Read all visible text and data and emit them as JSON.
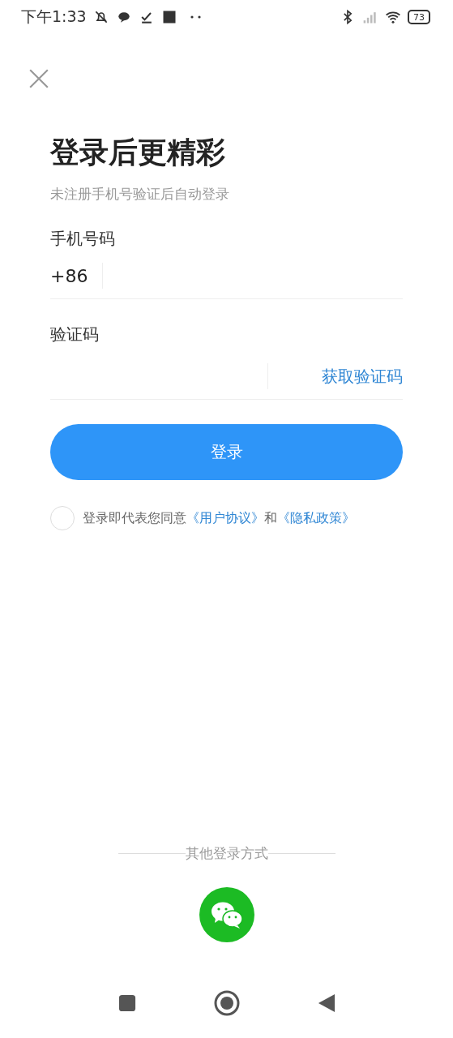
{
  "status_bar": {
    "time": "下午1:33",
    "battery": "73"
  },
  "title": "登录后更精彩",
  "subtitle": "未注册手机号验证后自动登录",
  "phone": {
    "label": "手机号码",
    "prefix": "+86"
  },
  "code": {
    "label": "验证码",
    "action": "获取验证码"
  },
  "login_button": "登录",
  "agreement": {
    "checked": false,
    "parts": [
      {
        "kind": "text",
        "text": "登录即代表您同意"
      },
      {
        "kind": "link",
        "text": "《用户协议》"
      },
      {
        "kind": "text",
        "text": "和"
      },
      {
        "kind": "link",
        "text": "《隐私政策》"
      }
    ]
  },
  "other_login": {
    "label": "其他登录方式"
  }
}
